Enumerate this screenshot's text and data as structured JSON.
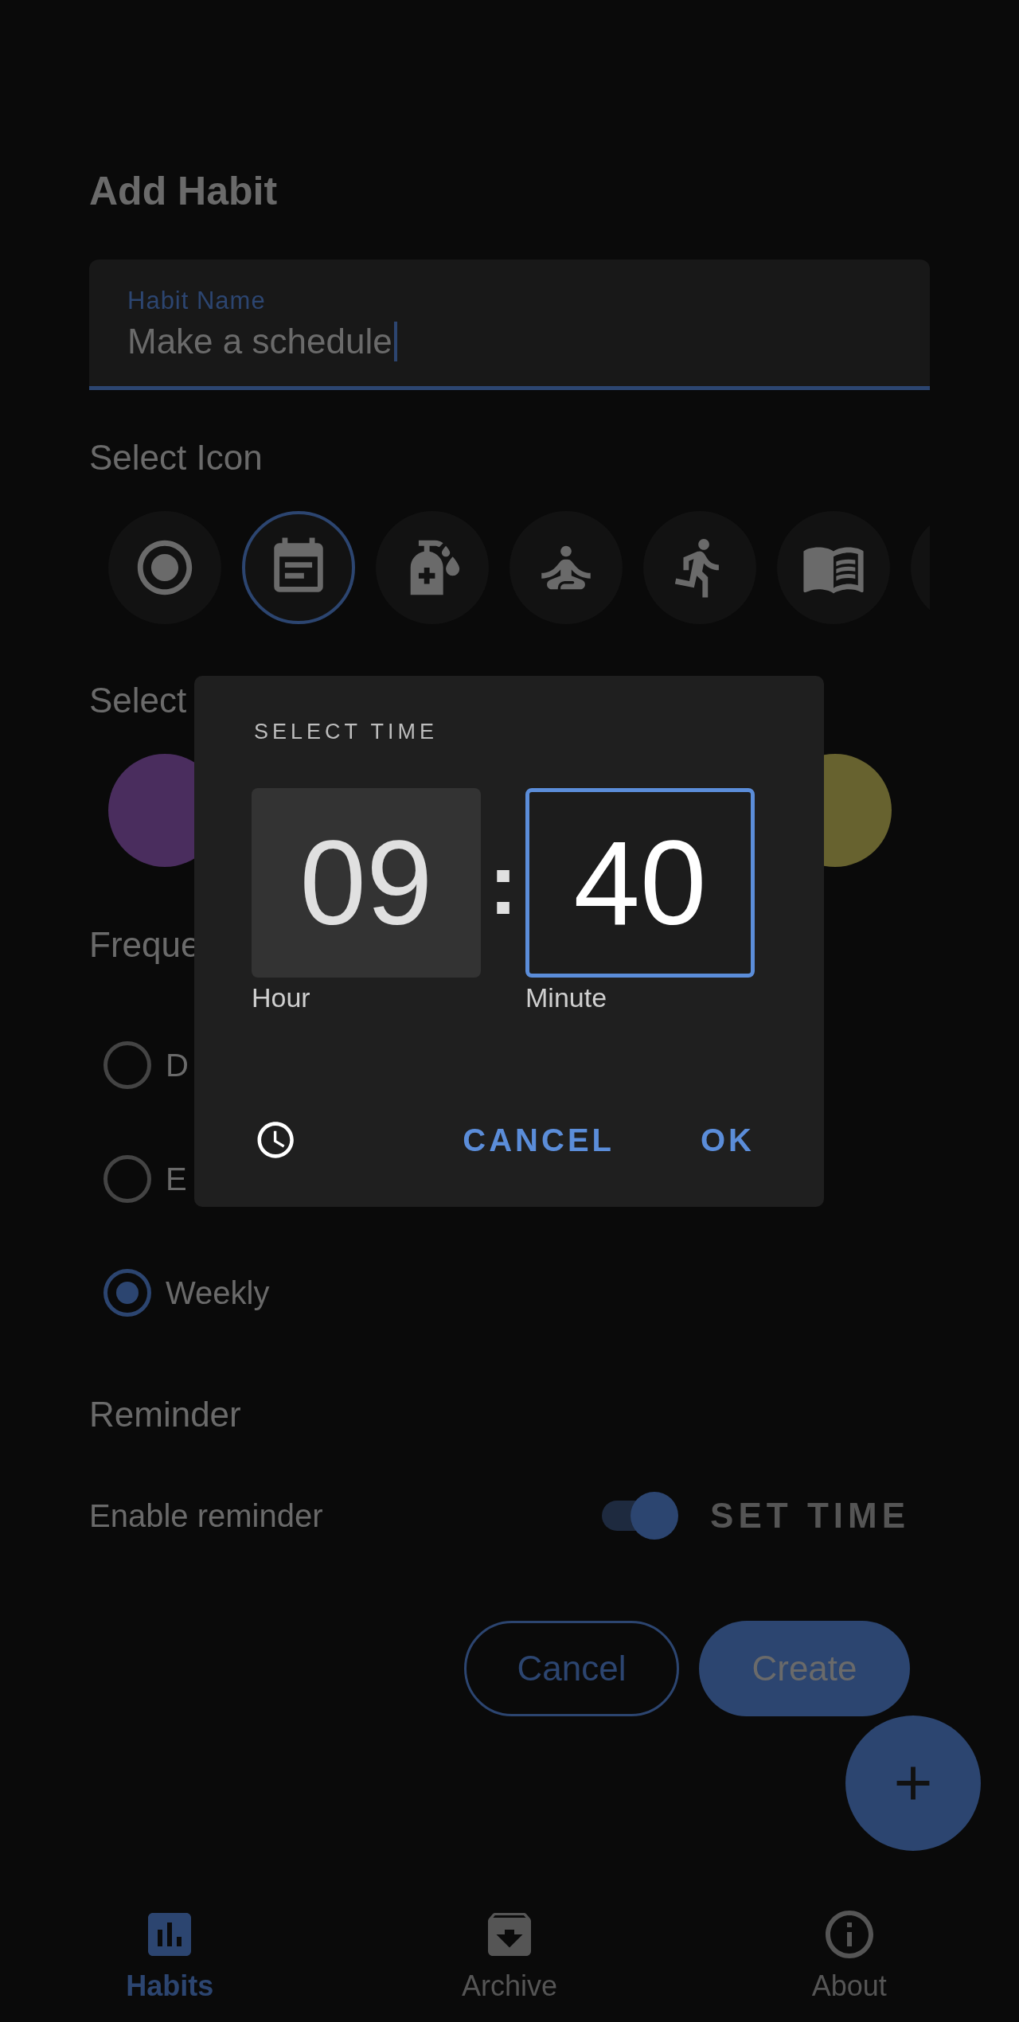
{
  "title": "Add Habit",
  "habit_name": {
    "label": "Habit Name",
    "value": "Make a schedule"
  },
  "icon_section": {
    "label": "Select Icon",
    "icons": [
      {
        "kind": "target",
        "selected": false
      },
      {
        "kind": "calendar",
        "selected": true
      },
      {
        "kind": "bottle",
        "selected": false
      },
      {
        "kind": "meditation",
        "selected": false
      },
      {
        "kind": "runner",
        "selected": false
      },
      {
        "kind": "book",
        "selected": false
      },
      {
        "kind": "blank",
        "selected": false
      }
    ]
  },
  "color_section": {
    "label": "Select",
    "colors": [
      {
        "color": "#4a2d5e"
      },
      {
        "color": "#67622f"
      }
    ]
  },
  "frequency_section": {
    "label": "Freque",
    "options": [
      {
        "label": "D",
        "selected": false
      },
      {
        "label": "E",
        "selected": false
      },
      {
        "label": "Weekly",
        "selected": true
      }
    ]
  },
  "reminder": {
    "label": "Reminder",
    "toggle_label": "Enable reminder",
    "on": true,
    "set_time": "SET TIME"
  },
  "actions": {
    "cancel": "Cancel",
    "create": "Create"
  },
  "time_dialog": {
    "title": "SELECT TIME",
    "hour": "09",
    "minute": "40",
    "separator": ":",
    "hour_label": "Hour",
    "minute_label": "Minute",
    "fields": [
      {
        "selected": false
      },
      {
        "selected": true
      }
    ],
    "cancel": "CANCEL",
    "ok": "OK"
  },
  "bottom_nav": [
    {
      "kind": "chart",
      "label": "Habits",
      "selected": true
    },
    {
      "kind": "archive",
      "label": "Archive",
      "selected": false
    },
    {
      "kind": "info",
      "label": "About",
      "selected": false
    }
  ]
}
